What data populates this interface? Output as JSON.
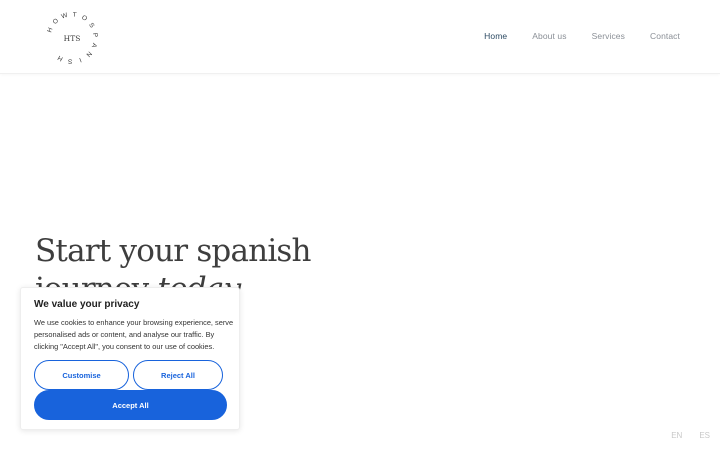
{
  "logo": {
    "ring_text": "HOW TO SPANISH",
    "monogram": "HTS"
  },
  "nav": {
    "items": [
      {
        "label": "Home",
        "active": true
      },
      {
        "label": "About us",
        "active": false
      },
      {
        "label": "Services",
        "active": false
      },
      {
        "label": "Contact",
        "active": false
      }
    ]
  },
  "hero": {
    "title_line1": "Start your spanish",
    "title_line2_plain": "journey ",
    "title_line2_italic": "today"
  },
  "cookie_banner": {
    "title": "We value your privacy",
    "body": "We use cookies to enhance your browsing experience, serve personalised ads or content, and analyse our traffic. By clicking \"Accept All\", you consent to our use of cookies.",
    "customise_label": "Customise",
    "reject_label": "Reject All",
    "accept_label": "Accept All"
  },
  "language": {
    "options": [
      "EN",
      "ES"
    ]
  },
  "colors": {
    "accent_blue": "#1863dc",
    "nav_active": "#2c4a63",
    "nav_inactive": "#8a8f96"
  }
}
